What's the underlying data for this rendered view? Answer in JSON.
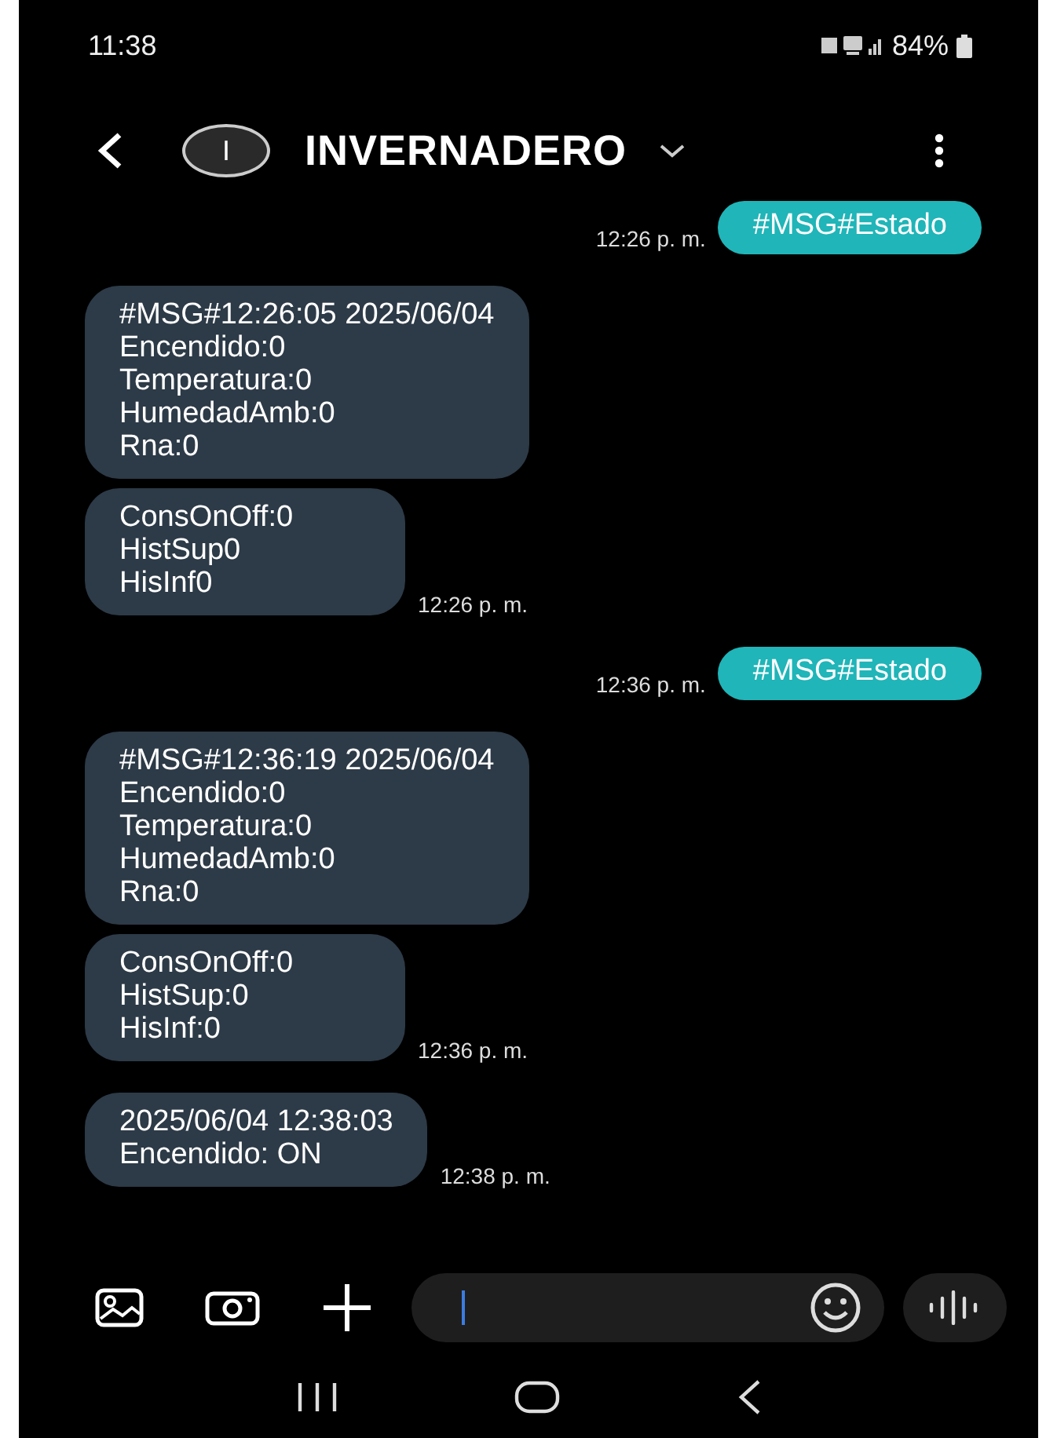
{
  "status_bar": {
    "time": "11:38",
    "battery": "84%"
  },
  "header": {
    "avatar_letter": "I",
    "title": "INVERNADERO"
  },
  "messages": [
    {
      "kind": "sent",
      "text": "#MSG#Estado",
      "time": "12:26 p. m."
    },
    {
      "kind": "received",
      "text": "#MSG#12:26:05 2025/06/04\nEncendido:0\nTemperatura:0\nHumedadAmb:0\nRna:0"
    },
    {
      "kind": "received",
      "text": "ConsOnOff:0\nHistSup0\nHisInf0",
      "time": "12:26 p. m."
    },
    {
      "kind": "sent",
      "text": "#MSG#Estado",
      "time": "12:36 p. m."
    },
    {
      "kind": "received",
      "text": "#MSG#12:36:19 2025/06/04\nEncendido:0\nTemperatura:0\nHumedadAmb:0\nRna:0"
    },
    {
      "kind": "received",
      "text": "ConsOnOff:0\nHistSup:0\nHisInf:0",
      "time": "12:36 p. m."
    },
    {
      "kind": "received",
      "text": "2025/06/04 12:38:03\nEncendido: ON",
      "time": "12:38 p. m."
    }
  ]
}
